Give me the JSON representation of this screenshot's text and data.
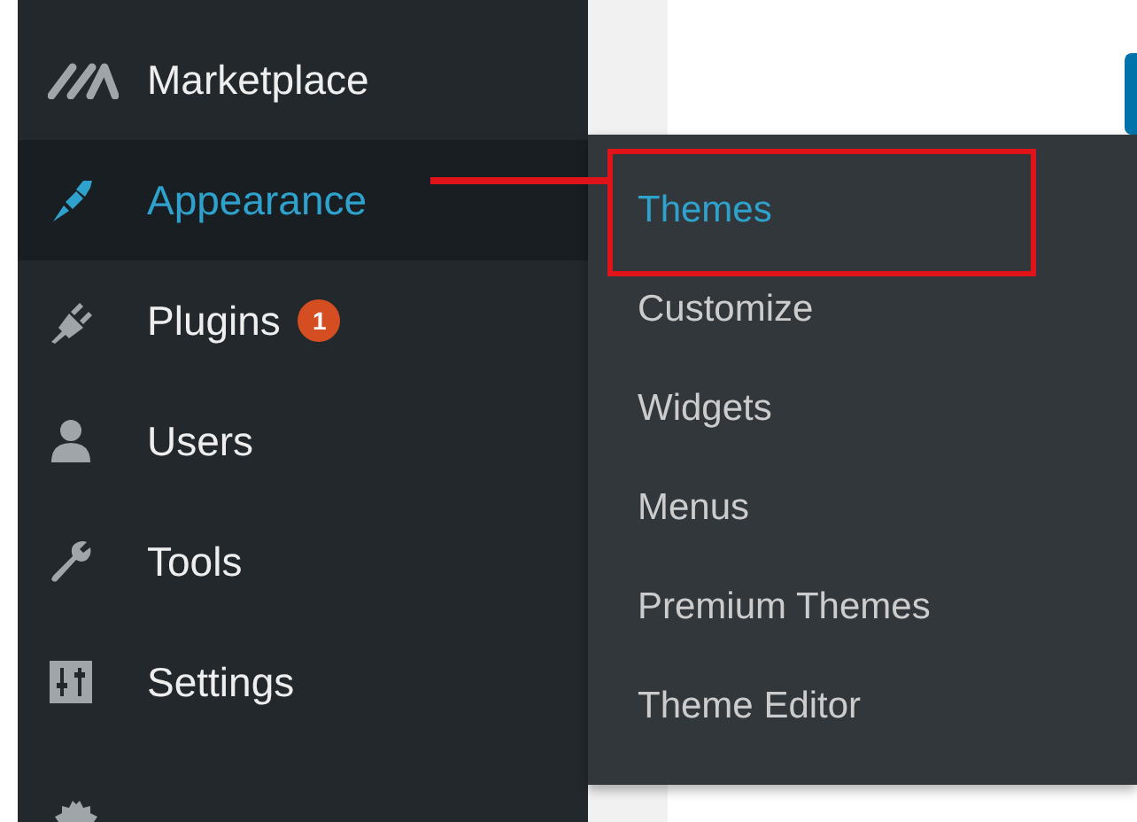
{
  "sidebar": {
    "items": [
      {
        "label": "Marketplace",
        "selected": false,
        "annotated": false
      },
      {
        "label": "Appearance",
        "selected": true,
        "annotated": true
      },
      {
        "label": "Plugins",
        "selected": false,
        "annotated": false,
        "badge": "1"
      },
      {
        "label": "Users",
        "selected": false,
        "annotated": false
      },
      {
        "label": "Tools",
        "selected": false,
        "annotated": false
      },
      {
        "label": "Settings",
        "selected": false,
        "annotated": false
      }
    ]
  },
  "submenu": {
    "items": [
      {
        "label": "Themes",
        "selected": true,
        "annotated": true
      },
      {
        "label": "Customize",
        "selected": false,
        "annotated": false
      },
      {
        "label": "Widgets",
        "selected": false,
        "annotated": false
      },
      {
        "label": "Menus",
        "selected": false,
        "annotated": false
      },
      {
        "label": "Premium Themes",
        "selected": false,
        "annotated": false
      },
      {
        "label": "Theme Editor",
        "selected": false,
        "annotated": false
      }
    ]
  }
}
